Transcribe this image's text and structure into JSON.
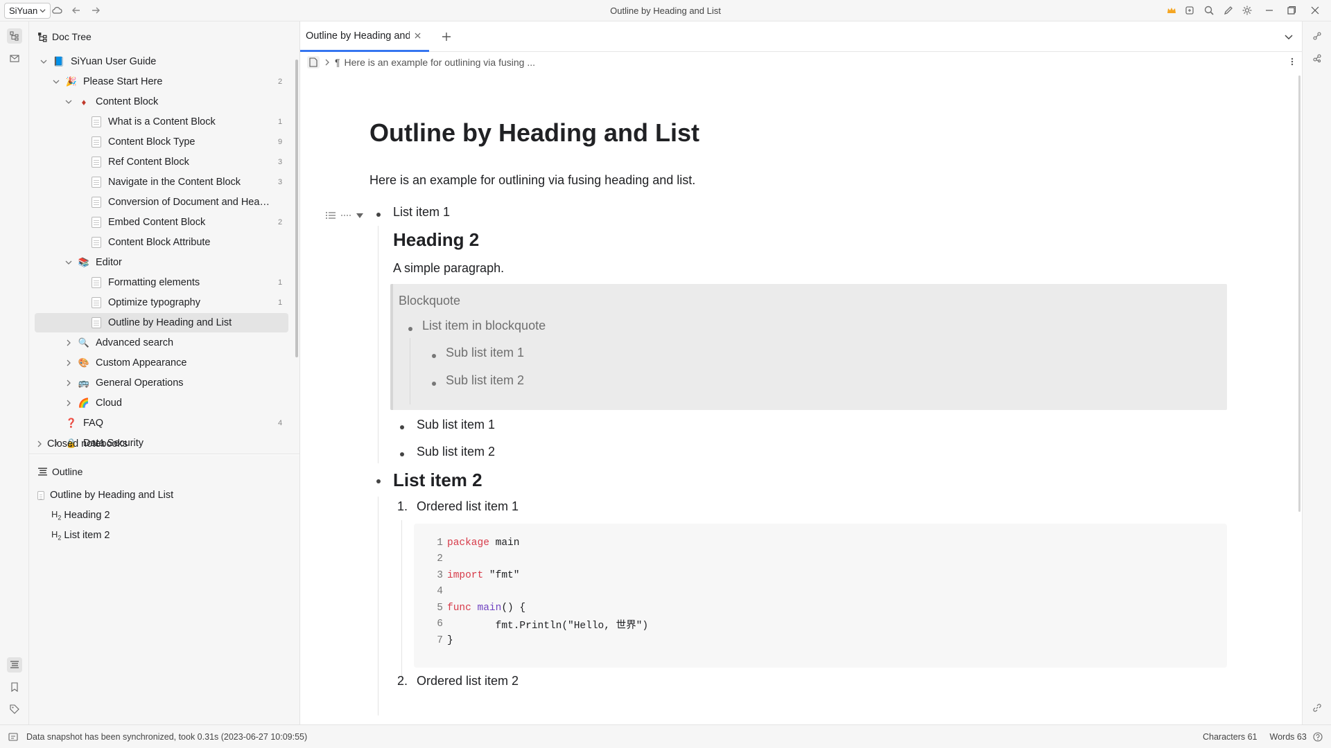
{
  "titlebar": {
    "workspace": "SiYuan",
    "title": "Outline by Heading and List",
    "icons_left": [
      "cloud-icon",
      "back-icon",
      "forward-icon"
    ],
    "icons_right": [
      "crown-icon",
      "sync-icon",
      "search-icon",
      "edit-icon",
      "settings-icon",
      "minimize-icon",
      "restore-icon",
      "close-icon"
    ],
    "accent": "#f5a623"
  },
  "left_dock": {
    "top_icons": [
      "file-tree-icon",
      "inbox-icon"
    ],
    "bottom_icons": [
      "outline-icon",
      "bookmark-icon",
      "tag-icon"
    ]
  },
  "right_dock": {
    "icons": [
      "graph-icon",
      "global-graph-icon",
      "link-icon",
      "help-icon"
    ]
  },
  "doc_tree": {
    "title": "Doc Tree",
    "items": [
      {
        "label": "SiYuan User Guide",
        "count": "",
        "depth": 0,
        "arrow": "down",
        "emoji": "📘"
      },
      {
        "label": "Please Start Here",
        "count": "2",
        "depth": 1,
        "arrow": "down",
        "emoji": "🎉"
      },
      {
        "label": "Content Block",
        "count": "",
        "depth": 2,
        "arrow": "down",
        "emoji": "♦"
      },
      {
        "label": "What is a Content Block",
        "count": "1",
        "depth": 3,
        "arrow": "none",
        "emoji": "doc"
      },
      {
        "label": "Content Block Type",
        "count": "9",
        "depth": 3,
        "arrow": "none",
        "emoji": "doc"
      },
      {
        "label": "Ref Content Block",
        "count": "3",
        "depth": 3,
        "arrow": "none",
        "emoji": "doc"
      },
      {
        "label": "Navigate in the Content Block",
        "count": "3",
        "depth": 3,
        "arrow": "none",
        "emoji": "doc"
      },
      {
        "label": "Conversion of Document and Head...",
        "count": "",
        "depth": 3,
        "arrow": "none",
        "emoji": "doc"
      },
      {
        "label": "Embed Content Block",
        "count": "2",
        "depth": 3,
        "arrow": "none",
        "emoji": "doc"
      },
      {
        "label": "Content Block Attribute",
        "count": "",
        "depth": 3,
        "arrow": "none",
        "emoji": "doc"
      },
      {
        "label": "Editor",
        "count": "",
        "depth": 2,
        "arrow": "down",
        "emoji": "📚"
      },
      {
        "label": "Formatting elements",
        "count": "1",
        "depth": 3,
        "arrow": "none",
        "emoji": "doc"
      },
      {
        "label": "Optimize typography",
        "count": "1",
        "depth": 3,
        "arrow": "none",
        "emoji": "doc"
      },
      {
        "label": "Outline by Heading and List",
        "count": "",
        "depth": 3,
        "arrow": "none",
        "emoji": "doc",
        "focus": true
      },
      {
        "label": "Advanced search",
        "count": "",
        "depth": 2,
        "arrow": "right",
        "emoji": "🔍"
      },
      {
        "label": "Custom Appearance",
        "count": "",
        "depth": 2,
        "arrow": "right",
        "emoji": "🎨"
      },
      {
        "label": "General Operations",
        "count": "",
        "depth": 2,
        "arrow": "right",
        "emoji": "🚌"
      },
      {
        "label": "Cloud",
        "count": "",
        "depth": 2,
        "arrow": "right",
        "emoji": "🌈"
      },
      {
        "label": "FAQ",
        "count": "4",
        "depth": 1,
        "arrow": "none",
        "emoji": "❓"
      },
      {
        "label": "Data Security",
        "count": "",
        "depth": 1,
        "arrow": "right",
        "emoji": "🔒"
      }
    ],
    "closed_notebooks": "Closed notebooks"
  },
  "outline": {
    "title": "Outline",
    "doc": "Outline by Heading and List",
    "headings": [
      {
        "level": "H2",
        "label": "Heading 2"
      },
      {
        "level": "H2",
        "label": "List item 2"
      }
    ]
  },
  "editor": {
    "tab_label": "Outline by Heading and List",
    "breadcrumb": "Here is an example for outlining via fusing ...",
    "doc_title": "Outline by Heading and List",
    "intro": "Here is an example for outlining via fusing heading and list.",
    "list_item_1": "List item 1",
    "heading_2": "Heading 2",
    "simple_paragraph": "A simple paragraph.",
    "blockquote": {
      "title": "Blockquote",
      "item": "List item in blockquote",
      "sub_items": [
        "Sub list item 1",
        "Sub list item 2"
      ]
    },
    "sub_items": [
      "Sub list item 1",
      "Sub list item 2"
    ],
    "list_item_2": "List item 2",
    "ordered_items": [
      "Ordered list item 1",
      "Ordered list item 2"
    ],
    "ordered_nums": [
      "1.",
      "2."
    ],
    "code": [
      {
        "ln": "1",
        "tokens": [
          {
            "t": "package",
            "c": "kw"
          },
          {
            "t": " main",
            "c": ""
          }
        ]
      },
      {
        "ln": "2",
        "tokens": []
      },
      {
        "ln": "3",
        "tokens": [
          {
            "t": "import",
            "c": "kw"
          },
          {
            "t": " \"fmt\"",
            "c": "str"
          }
        ]
      },
      {
        "ln": "4",
        "tokens": []
      },
      {
        "ln": "5",
        "tokens": [
          {
            "t": "func",
            "c": "kw"
          },
          {
            "t": " ",
            "c": ""
          },
          {
            "t": "main",
            "c": "kw2"
          },
          {
            "t": "() {",
            "c": ""
          }
        ]
      },
      {
        "ln": "6",
        "tokens": [
          {
            "t": "        fmt.Println(\"Hello, 世界\")",
            "c": ""
          }
        ]
      },
      {
        "ln": "7",
        "tokens": [
          {
            "t": "}",
            "c": ""
          }
        ]
      }
    ]
  },
  "status": {
    "message": "Data snapshot has been synchronized, took 0.31s (2023-06-27 10:09:55)",
    "characters": "Characters 61",
    "words": "Words 63"
  }
}
